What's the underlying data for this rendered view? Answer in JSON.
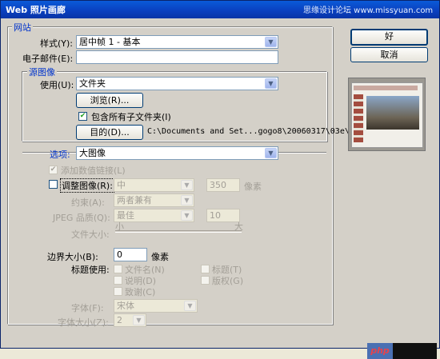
{
  "title": "Web 照片画廊",
  "watermark": "思缘设计论坛 www.missyuan.com",
  "site_group": {
    "label": "网站",
    "style_label": "样式(Y):",
    "style_value": "居中帧 1 - 基本",
    "email_label": "电子邮件(E):",
    "email_value": ""
  },
  "source_group": {
    "label": "源图像",
    "use_label": "使用(U):",
    "use_value": "文件夹",
    "browse_label": "浏览(R)...",
    "include_subfolders_label": "包含所有子文件夹(I)",
    "include_subfolders_checked": true,
    "dest_label": "目的(D)...",
    "dest_path": "C:\\Documents and Set...gogo8\\20060317\\03e\\"
  },
  "options": {
    "label": "选项:",
    "value": "大图像",
    "add_links_label": "添加数值链接(L)",
    "resize_label": "调整图像(R):",
    "resize_value": "中",
    "resize_px": "350",
    "resize_unit": "像素",
    "constrain_label": "约束(A):",
    "constrain_value": "两者兼有",
    "jpeg_label": "JPEG 品质(Q):",
    "jpeg_value": "最佳",
    "jpeg_num": "10",
    "filesize_label": "文件大小:",
    "filesize_small": "小",
    "filesize_large": "大",
    "border_label": "边界大小(B):",
    "border_value": "0",
    "border_unit": "像素",
    "title_use_label": "标题使用:",
    "cb_filename": "文件名(N)",
    "cb_caption": "说明(D)",
    "cb_credits": "致谢(C)",
    "cb_title": "标题(T)",
    "cb_copyright": "版权(G)",
    "font_label": "字体(F):",
    "font_value": "宋体",
    "font_size_label": "字体大小(Z):",
    "font_size_value": "2"
  },
  "buttons": {
    "ok": "好",
    "cancel": "取消"
  },
  "badge": "php"
}
